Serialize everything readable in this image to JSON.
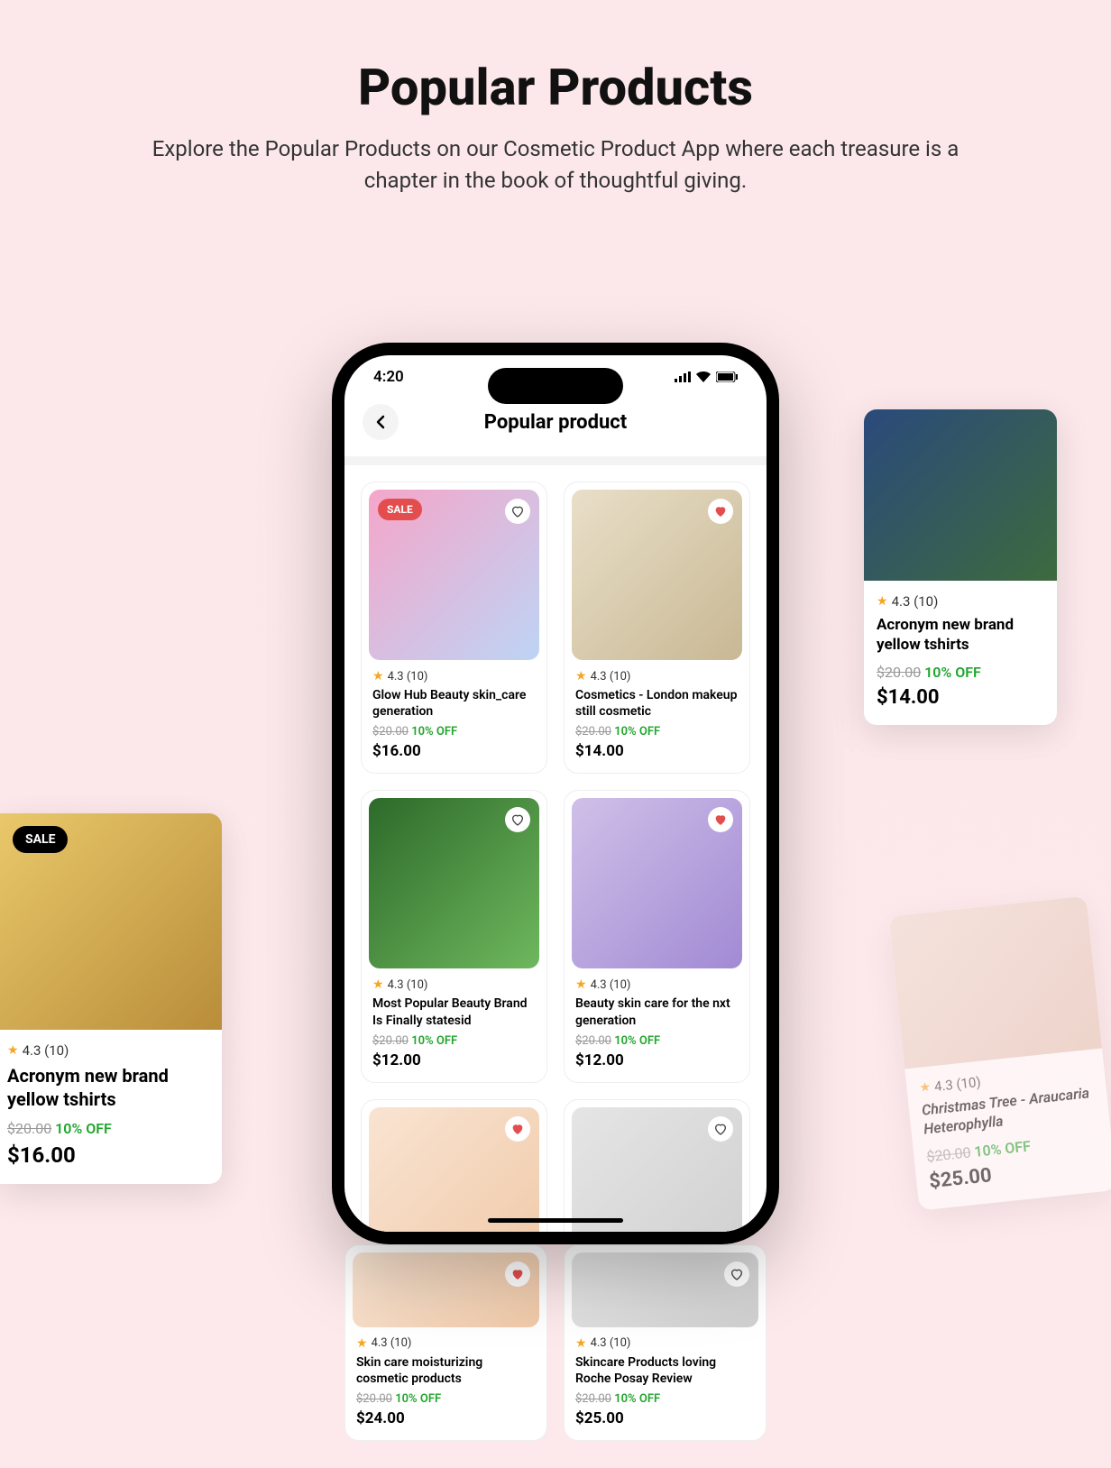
{
  "hero": {
    "title": "Popular Products",
    "subtitle": "Explore the Popular Products on our Cosmetic Product App where each treasure is a chapter in the book of thoughtful giving."
  },
  "phone": {
    "time": "4:20",
    "screen_title": "Popular product",
    "sale_label": "SALE",
    "products": [
      {
        "title": "Glow Hub Beauty skin_care generation",
        "rating": "4.3 (10)",
        "old_price": "$20.00",
        "discount": "10% OFF",
        "price": "$16.00",
        "sale": true,
        "favorite": false,
        "bg": "bg-a"
      },
      {
        "title": "Cosmetics - London makeup still cosmetic",
        "rating": "4.3 (10)",
        "old_price": "$20.00",
        "discount": "10% OFF",
        "price": "$14.00",
        "sale": false,
        "favorite": true,
        "bg": "bg-b"
      },
      {
        "title": "Most Popular Beauty Brand Is Finally statesid",
        "rating": "4.3 (10)",
        "old_price": "$20.00",
        "discount": "10% OFF",
        "price": "$12.00",
        "sale": false,
        "favorite": false,
        "bg": "bg-c"
      },
      {
        "title": "Beauty skin care for the nxt generation",
        "rating": "4.3 (10)",
        "old_price": "$20.00",
        "discount": "10% OFF",
        "price": "$12.00",
        "sale": false,
        "favorite": true,
        "bg": "bg-d"
      },
      {
        "title": "Skin care moisturizing cosmetic products",
        "rating": "4.3 (10)",
        "old_price": "$20.00",
        "discount": "10% OFF",
        "price": "$24.00",
        "sale": false,
        "favorite": true,
        "bg": "bg-e"
      },
      {
        "title": "Skincare Products loving Roche Posay Review",
        "rating": "4.3 (10)",
        "old_price": "$20.00",
        "discount": "10% OFF",
        "price": "$25.00",
        "sale": false,
        "favorite": false,
        "bg": "bg-f"
      }
    ]
  },
  "float_left": {
    "sale_label": "SALE",
    "rating": "4.3 (10)",
    "title": "Acronym new brand yellow tshirts",
    "old_price": "$20.00",
    "discount": "10% OFF",
    "price": "$16.00"
  },
  "float_right": {
    "rating": "4.3 (10)",
    "title": "Acronym new brand yellow tshirts",
    "old_price": "$20.00",
    "discount": "10% OFF",
    "price": "$14.00"
  },
  "float_br": {
    "rating": "4.3 (10)",
    "title": "Christmas Tree - Araucaria Heterophylla",
    "old_price": "$20.00",
    "discount": "10% OFF",
    "price": "$25.00"
  }
}
